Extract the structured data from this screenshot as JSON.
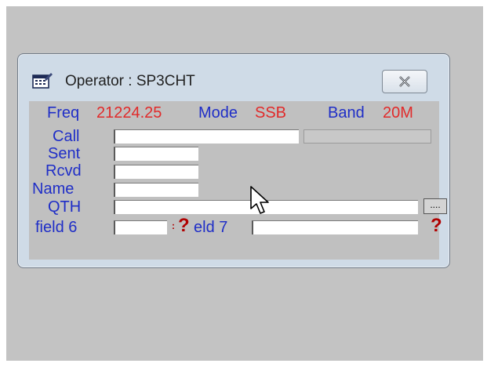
{
  "window": {
    "title": "Operator : SP3CHT",
    "close_icon": "close-icon"
  },
  "status": {
    "freq_label": "Freq",
    "freq_value": "21224.25",
    "mode_label": "Mode",
    "mode_value": "SSB",
    "band_label": "Band",
    "band_value": "20M"
  },
  "fields": {
    "call_label": "Call",
    "call_value": "",
    "sent_label": "Sent",
    "sent_value": "",
    "rcvd_label": "Rcvd",
    "rcvd_value": "",
    "name_label": "Name",
    "name_value": "",
    "qth_label": "QTH",
    "qth_value": "",
    "qth_button_label": "....",
    "field6_label": "field 6",
    "field6_value": "",
    "field7_label": "eld 7",
    "field7_value": "",
    "help_mark": "?"
  },
  "colors": {
    "label": "#1f2ec7",
    "value": "#e12a2a",
    "help": "#b00000"
  }
}
